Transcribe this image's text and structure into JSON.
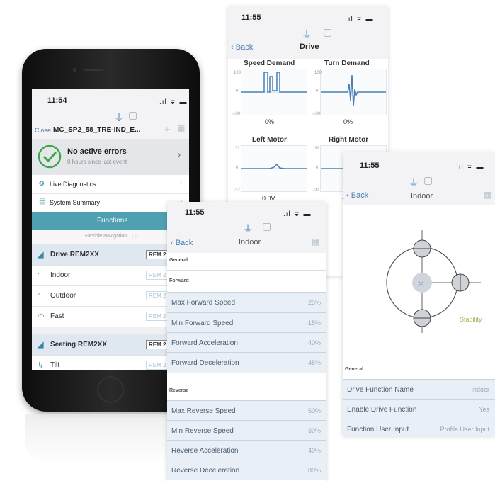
{
  "drive_screen": {
    "time": "11:55",
    "back_label": "Back",
    "title": "Drive",
    "speed_demand": {
      "label": "Speed Demand",
      "value": "0%",
      "y_top": "100",
      "y_mid": "0",
      "y_bot": "-100"
    },
    "turn_demand": {
      "label": "Turn Demand",
      "value": "0%",
      "y_top": "100",
      "y_mid": "0",
      "y_bot": "-100"
    },
    "left_motor": {
      "label": "Left Motor",
      "value": "0.0V",
      "y_top": "32",
      "y_mid": "0",
      "y_bot": "-32"
    },
    "right_motor": {
      "label": "Right Motor",
      "value": "-",
      "y_top": "32",
      "y_mid": "0",
      "y_bot": "-32"
    }
  },
  "indoor_screen_right": {
    "time": "11:55",
    "back_label": "Back",
    "title": "Indoor",
    "stability_label": "Stability",
    "section_general": "General",
    "rows": [
      {
        "label": "Drive Function Name",
        "value": "Indoor"
      },
      {
        "label": "Enable Drive Function",
        "value": "Yes"
      },
      {
        "label": "Function User Input",
        "value": "Profile User Input"
      }
    ]
  },
  "phone": {
    "time": "11:54",
    "close_label": "Close",
    "device_name": "MC_SP2_58_TRE-IND_E...",
    "errors_title": "No active errors",
    "errors_sub": "0 hours since last event",
    "menu": [
      {
        "label": "Live Diagnostics"
      },
      {
        "label": "System Summary"
      }
    ],
    "functions_label": "Functions",
    "flexible_nav": "Flexible Navigation",
    "functions": [
      {
        "name": "Drive REM2XX",
        "badge": "REM 2",
        "head": true,
        "icon": "drive-icon"
      },
      {
        "name": "Indoor",
        "badge": "REM 2",
        "head": false,
        "icon": "speed-gauge-icon"
      },
      {
        "name": "Outdoor",
        "badge": "REM 2",
        "head": false,
        "icon": "speed-gauge-icon"
      },
      {
        "name": "Fast",
        "badge": "REM 2",
        "head": false,
        "icon": "speed-gauge-icon"
      },
      {
        "name": "Seating REM2XX",
        "badge": "REM 2",
        "head": true,
        "icon": "seat-icon"
      },
      {
        "name": "Tilt",
        "badge": "REM 2",
        "head": false,
        "icon": "tilt-icon"
      }
    ]
  },
  "indoor_screen_center": {
    "time": "11:55",
    "back_label": "Back",
    "title": "Indoor",
    "section_general": "General",
    "section_forward": "Forward",
    "section_reverse": "Reverse",
    "forward_rows": [
      {
        "label": "Max Forward Speed",
        "value": "25%"
      },
      {
        "label": "Min Forward Speed",
        "value": "15%"
      },
      {
        "label": "Forward Acceleration",
        "value": "40%"
      },
      {
        "label": "Forward Deceleration",
        "value": "45%"
      }
    ],
    "reverse_rows": [
      {
        "label": "Max Reverse Speed",
        "value": "50%"
      },
      {
        "label": "Min Reverse Speed",
        "value": "30%"
      },
      {
        "label": "Reverse Acceleration",
        "value": "40%"
      },
      {
        "label": "Reverse Deceleration",
        "value": "80%"
      }
    ]
  },
  "colors": {
    "accent": "#4a7fb5",
    "functions_bar": "#4fa0b0",
    "green_check": "#3aa84a",
    "row_bg": "#e9eff6"
  }
}
